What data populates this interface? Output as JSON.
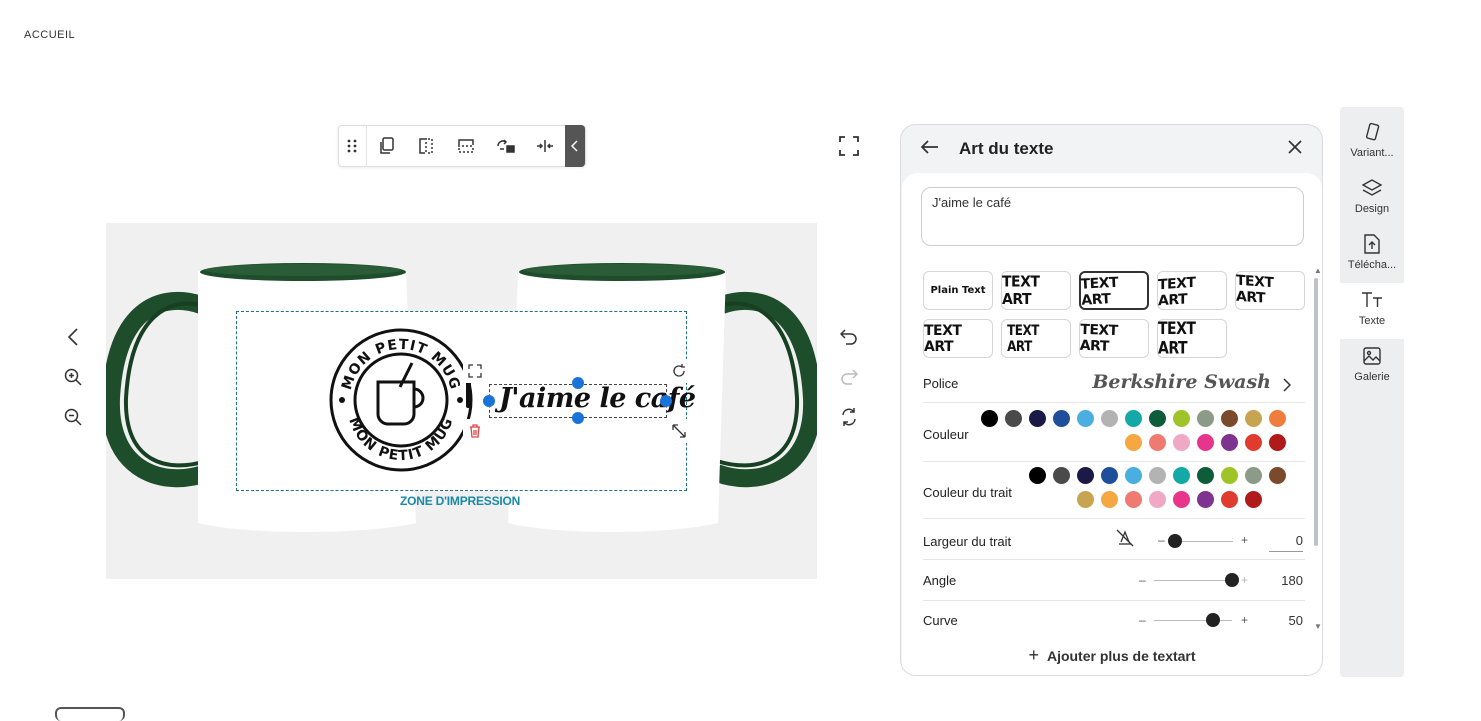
{
  "breadcrumb": "ACCUEIL",
  "canvas": {
    "zone_label": "ZONE D'IMPRESSION",
    "design_text": "J'aime le café",
    "logo_text_top": "MON PETIT MUG",
    "logo_text_bottom": "MON PETIT MUG"
  },
  "toolbar": {
    "icons": [
      "grip-icon",
      "duplicate-icon",
      "flip-horizontal-icon",
      "flip-vertical-icon",
      "replace-icon",
      "center-icon",
      "collapse-icon"
    ]
  },
  "panel": {
    "title": "Art du texte",
    "text_value": "J'aime le café",
    "styles": [
      "Plain Text",
      "TEXT ART",
      "TEXT ART",
      "TEXT ART",
      "TEXT ART",
      "TEXT ART",
      "TEXT ART",
      "TEXT ART",
      "TEXT ART"
    ],
    "selected_style_index": 2,
    "font_label": "Police",
    "font_value": "Berkshire Swash",
    "color_label": "Couleur",
    "stroke_color_label": "Couleur du trait",
    "stroke_width_label": "Largeur du trait",
    "stroke_width_value": "0",
    "angle_label": "Angle",
    "angle_value": "180",
    "curve_label": "Curve",
    "curve_value": "50",
    "minus": "–",
    "plus": "+",
    "add_more": "Ajouter plus de textart",
    "colors": [
      "#000000",
      "#4a4a4a",
      "#1b1a47",
      "#1f4f9a",
      "#4aaee0",
      "#b3b3b3",
      "#14a9a6",
      "#0e5c3a",
      "#9fc42a",
      "#8c9a88",
      "#7b4a2c",
      "#c6a452",
      "#ef7d3d",
      "#f5a841",
      "#ee7a72",
      "#f0a9c5",
      "#e6358b",
      "#7e3390",
      "#df3b2e",
      "#b11a1a"
    ],
    "stroke_colors": [
      "#000000",
      "#4a4a4a",
      "#1b1a47",
      "#1f4f9a",
      "#4aaee0",
      "#b3b3b3",
      "#14a9a6",
      "#0e5c3a",
      "#9fc42a",
      "#8c9a88",
      "#7b4a2c",
      "#c6a452",
      "#f5a841",
      "#ee7a72",
      "#f0a9c5",
      "#e6358b",
      "#7e3390",
      "#df3b2e",
      "#b11a1a"
    ]
  },
  "rail": {
    "items": [
      {
        "label": "Variant...",
        "icon": "variant-icon"
      },
      {
        "label": "Design",
        "icon": "layers-icon"
      },
      {
        "label": "Télécha...",
        "icon": "upload-icon"
      },
      {
        "label": "Texte",
        "icon": "text-icon"
      },
      {
        "label": "Galerie",
        "icon": "gallery-icon"
      }
    ],
    "active_index": 3
  },
  "accent_color": "#1a73d9",
  "mug_color": "#1e4d2b"
}
